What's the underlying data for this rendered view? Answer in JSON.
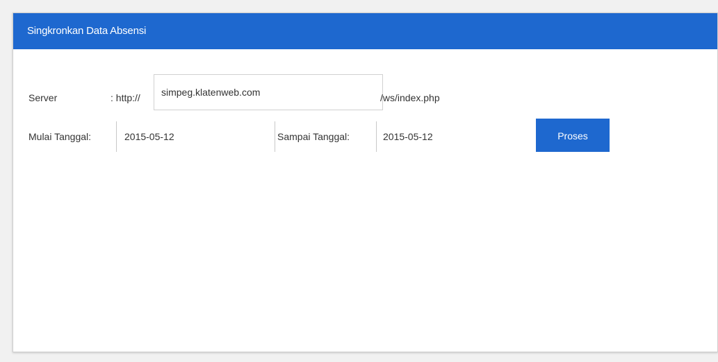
{
  "panel": {
    "title": "Singkronkan Data Absensi"
  },
  "server": {
    "label": "Server",
    "prefix": ": http://",
    "host_value": "simpeg.klatenweb.com",
    "suffix": "/ws/index.php"
  },
  "date_range": {
    "start_label": "Mulai Tanggal:",
    "start_value": "2015-05-12",
    "end_label": "Sampai Tanggal:",
    "end_value": "2015-05-12"
  },
  "actions": {
    "process_label": "Proses"
  },
  "colors": {
    "primary": "#1e68cf",
    "background": "#f1f1f1"
  }
}
